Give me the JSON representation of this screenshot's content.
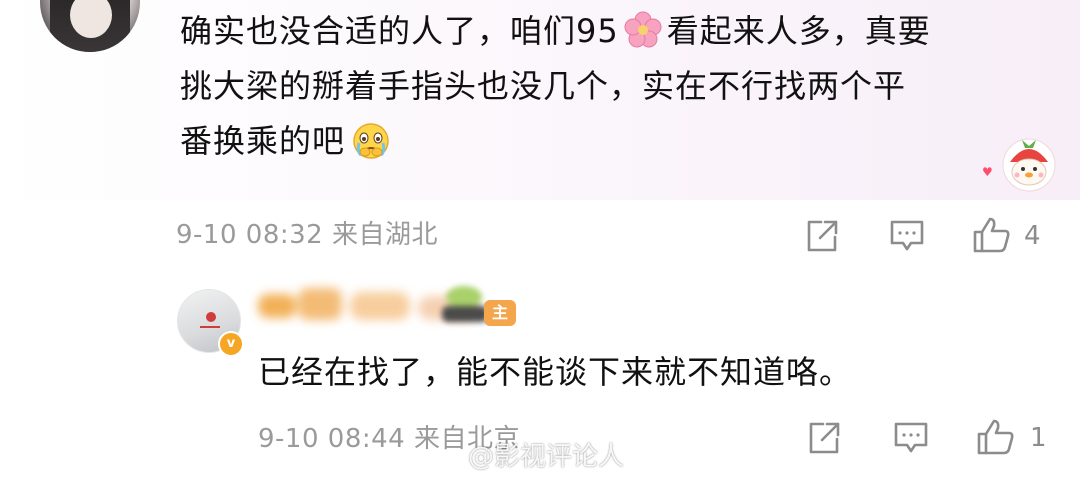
{
  "comment": {
    "lines": [
      {
        "before": "确实也没合适的人了，咱们95",
        "after": "看起来人多，真要"
      },
      {
        "text": "挑大梁的掰着手指头也没几个，实在不行找两个平"
      },
      {
        "text": "番换乘的吧"
      }
    ],
    "emojis": [
      "flower-emoji",
      "crying-face-emoji"
    ],
    "sticker": "strawberry-chick-sticker",
    "meta": "9-10 08:32 来自湖北",
    "likes": "4"
  },
  "reply": {
    "author_tag": "主",
    "text": "已经在找了，能不能谈下来就不知道咯。",
    "meta": "9-10 08:44 来自北京",
    "likes": "1",
    "badge": "v"
  },
  "actions": {
    "share_icon": "share-icon",
    "comment_icon": "comment-icon",
    "like_icon": "thumbs-up-icon"
  },
  "watermark": {
    "text": "@影视评论人",
    "logo": "weibo-logo-icon"
  },
  "colors": {
    "meta_gray": "#9a9a9a",
    "icon_gray": "#8c8c8c",
    "author_tag": "#f3a64c",
    "verified_badge": "#f5a623",
    "band": "#f7eef8"
  }
}
